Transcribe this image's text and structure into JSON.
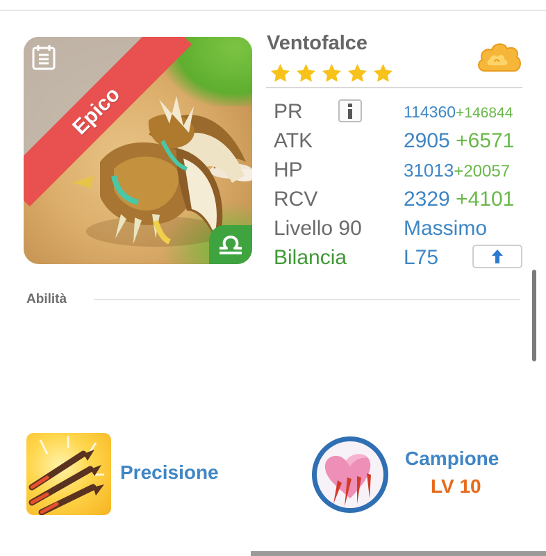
{
  "monster": {
    "name": "Ventofalce",
    "rarity": "Epico",
    "stars": 5,
    "element_icon": "cloud-icon",
    "zodiac_icon": "libra-icon"
  },
  "stats": {
    "pr": {
      "label": "PR",
      "value": "114360",
      "bonus": "+146844"
    },
    "atk": {
      "label": "ATK",
      "value": "2905",
      "bonus": "+6571"
    },
    "hp": {
      "label": "HP",
      "value": "31013",
      "bonus": "+20057"
    },
    "rcv": {
      "label": "RCV",
      "value": "2329",
      "bonus": "+4101"
    },
    "level": {
      "label": "Livello 90",
      "value": "Massimo"
    },
    "zodiac": {
      "label": "Bilancia",
      "value": "L75"
    }
  },
  "abilities": {
    "title": "Abilità",
    "skill": {
      "name": "Precisione",
      "icon": "arrows-icon"
    },
    "leader": {
      "name": "Campione",
      "level": "LV 10",
      "icon": "heart-claw-icon"
    }
  },
  "colors": {
    "accent_blue": "#3f86c4",
    "bonus_green": "#6ab84a",
    "rarity_red": "#e8514f",
    "zodiac_green": "#3fa340",
    "level_orange": "#e86a1b"
  }
}
